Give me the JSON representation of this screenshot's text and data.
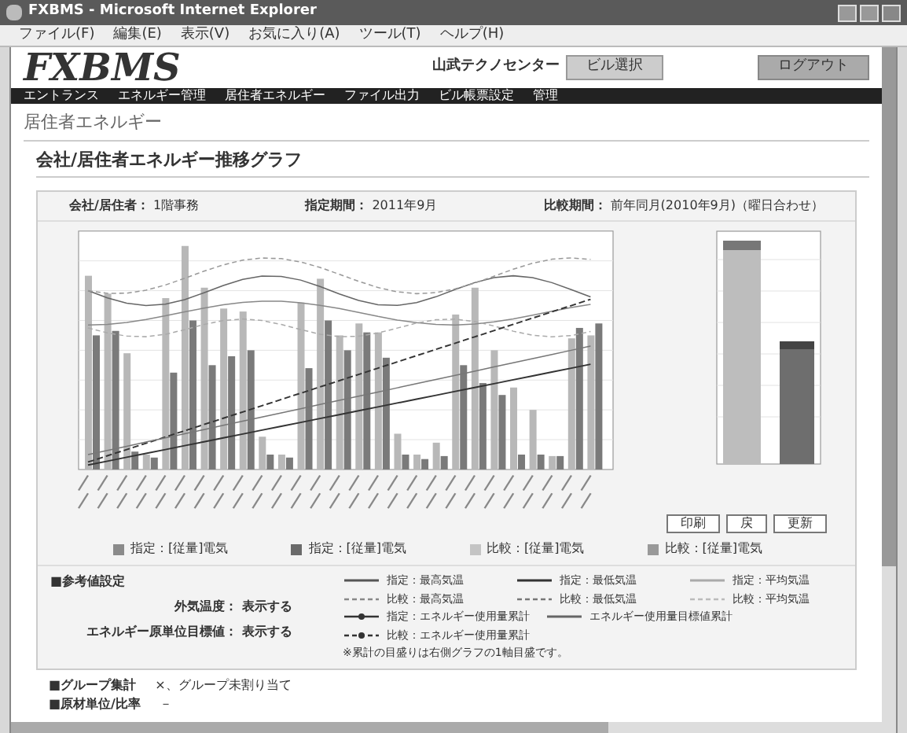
{
  "window": {
    "title": "FXBMS - Microsoft Internet Explorer"
  },
  "menu": [
    "ファイル(F)",
    "編集(E)",
    "表示(V)",
    "お気に入り(A)",
    "ツール(T)",
    "ヘルプ(H)"
  ],
  "header": {
    "logo": "FXBMS",
    "site": "山武テクノセンター",
    "site_button": "ビル選択",
    "logout_button": "ログアウト"
  },
  "nav": [
    "エントランス",
    "エネルギー管理",
    "居住者エネルギー",
    "ファイル出力",
    "ビル帳票設定",
    "管理"
  ],
  "page_title": "居住者エネルギー",
  "section_title": "会社/居住者エネルギー推移グラフ",
  "info": [
    {
      "label": "会社/居住者：",
      "value": "1階事務"
    },
    {
      "label": "指定期間：",
      "value": "2011年9月"
    },
    {
      "label": "比較期間：",
      "value": "前年同月(2010年9月)（曜日合わせ）"
    }
  ],
  "chart_buttons": [
    "印刷",
    "戻",
    "更新"
  ],
  "bar_legend": [
    {
      "label": "指定：[従量]電気",
      "color": "#8a8a8a"
    },
    {
      "label": "指定：[従量]電気",
      "color": "#6a6a6a"
    },
    {
      "label": "比較：[従量]電気",
      "color": "#c4c4c4"
    },
    {
      "label": "比較：[従量]電気",
      "color": "#999999"
    }
  ],
  "reference": {
    "heading": "■参考値設定",
    "rows": [
      {
        "label": "外気温度：",
        "value": "表示する"
      },
      {
        "label": "エネルギー原単位目標値：",
        "value": "表示する"
      }
    ]
  },
  "line_legend": [
    {
      "label": "指定：最高気温",
      "kind": "solid",
      "color": "#555555"
    },
    {
      "label": "指定：最低気温",
      "kind": "solid",
      "color": "#333333"
    },
    {
      "label": "指定：平均気温",
      "kind": "solid",
      "color": "#aaaaaa"
    },
    {
      "label": "比較：最高気温",
      "kind": "dash",
      "color": "#888888"
    },
    {
      "label": "比較：最低気温",
      "kind": "dash",
      "color": "#777777"
    },
    {
      "label": "比較：平均気温",
      "kind": "dash",
      "color": "#bbbbbb"
    },
    {
      "label": "指定：エネルギー使用量累計",
      "kind": "marker-solid",
      "color": "#333333"
    },
    {
      "label": "エネルギー使用量目標値累計",
      "kind": "solid",
      "color": "#666666"
    },
    {
      "label": "比較：エネルギー使用量累計",
      "kind": "marker-dash",
      "color": "#333333"
    }
  ],
  "line_note": "※累計の目盛りは右側グラフの1軸目盛です。",
  "footer_rows": [
    {
      "label": "■グループ集計",
      "value": "×、グループ未割り当て"
    },
    {
      "label": "■原材単位/比率",
      "value": "－"
    }
  ]
}
